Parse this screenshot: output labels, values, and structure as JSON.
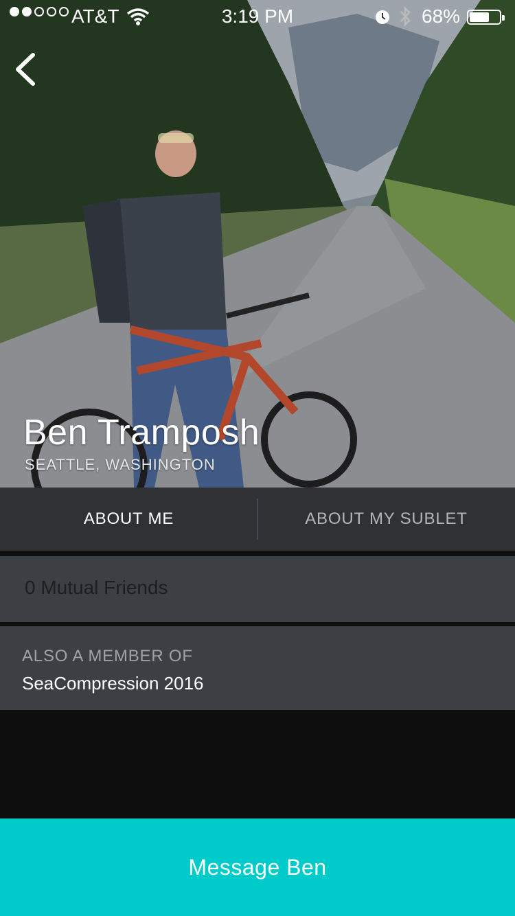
{
  "status_bar": {
    "carrier": "AT&T",
    "time": "3:19 PM",
    "battery_pct": "68%",
    "signal_bars_filled": 2,
    "signal_bars_total": 5
  },
  "profile": {
    "name": "Ben Tramposh",
    "location": "SEATTLE, WASHINGTON"
  },
  "tabs": [
    {
      "label": "ABOUT ME",
      "active": true
    },
    {
      "label": "ABOUT MY SUBLET",
      "active": false
    }
  ],
  "mutual_friends": "0 Mutual Friends",
  "membership": {
    "label": "ALSO A MEMBER OF",
    "value": "SeaCompression 2016"
  },
  "cta": {
    "label": "Message Ben"
  },
  "colors": {
    "accent": "#00cbcb",
    "tab_bar": "#2f3135",
    "panel": "#3c3f43",
    "background": "#0e0e0f"
  },
  "icons": [
    "back-chevron-icon",
    "wifi-icon",
    "alarm-icon",
    "bluetooth-icon",
    "battery-icon"
  ]
}
